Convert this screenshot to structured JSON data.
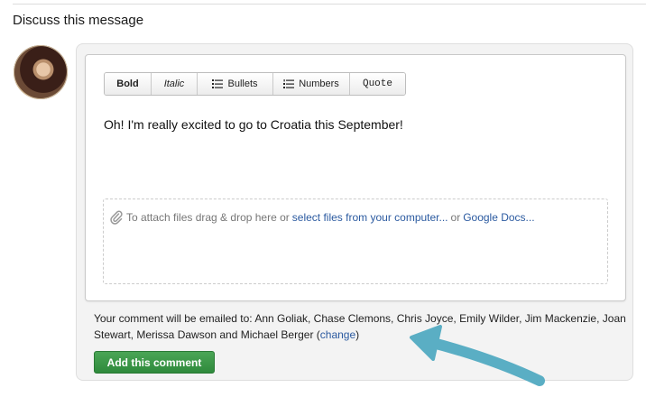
{
  "section": {
    "title": "Discuss this message"
  },
  "toolbar": {
    "bold": "Bold",
    "italic": "Italic",
    "bullets": "Bullets",
    "numbers": "Numbers",
    "quote": "Quote"
  },
  "editor": {
    "text": "Oh! I'm really excited to go to Croatia this September!"
  },
  "attach": {
    "icon": "paperclip-icon",
    "prefix": "To attach files drag & drop here or",
    "select_link": "select files from your computer...",
    "or": "or",
    "docs_link": "Google Docs..."
  },
  "recipients": {
    "text": "Your comment will be emailed to: Ann Goliak, Chase Clemons, Chris Joyce, Emily Wilder, Jim Mackenzie, Joan Stewart, Merissa Dawson and Michael Berger (",
    "change_link": "change",
    "close": ")"
  },
  "submit": {
    "label": "Add this comment"
  },
  "colors": {
    "accent_green": "#3a9a47",
    "link_blue": "#2b5aa0",
    "arrow_teal": "#5aaec4"
  }
}
